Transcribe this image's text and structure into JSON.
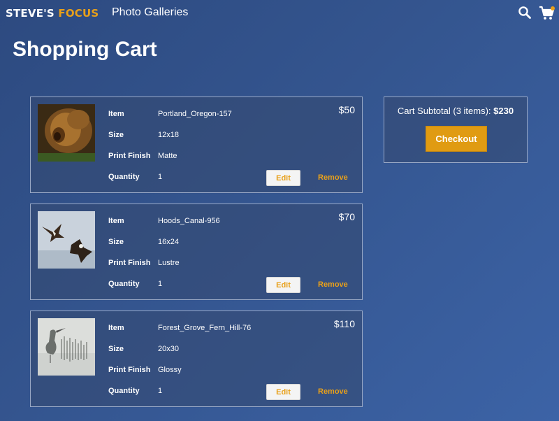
{
  "header": {
    "logo_word1": "STEVE'S",
    "logo_word2": "FOCUS",
    "nav_link": "Photo Galleries",
    "icons": [
      "search-icon",
      "cart-icon"
    ]
  },
  "page": {
    "title": "Shopping Cart"
  },
  "labels": {
    "item": "Item",
    "size": "Size",
    "finish": "Print Finish",
    "quantity": "Quantity",
    "edit": "Edit",
    "remove": "Remove"
  },
  "cart": {
    "items": [
      {
        "name": "Portland_Oregon-157",
        "size": "12x18",
        "finish": "Matte",
        "quantity": "1",
        "price": "$50"
      },
      {
        "name": "Hoods_Canal-956",
        "size": "16x24",
        "finish": "Lustre",
        "quantity": "1",
        "price": "$70"
      },
      {
        "name": "Forest_Grove_Fern_Hill-76",
        "size": "20x30",
        "finish": "Glossy",
        "quantity": "1",
        "price": "$110"
      }
    ]
  },
  "summary": {
    "subtotal_label": "Cart Subtotal (3 items):",
    "subtotal_amount": "$230",
    "checkout_label": "Checkout"
  },
  "colors": {
    "accent": "#e8a01a",
    "background": "#34558f"
  }
}
